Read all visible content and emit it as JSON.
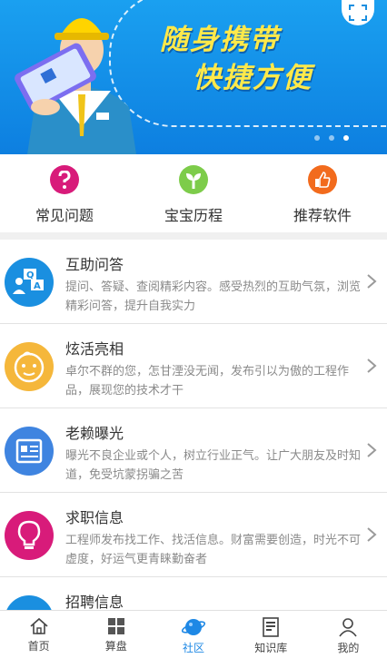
{
  "banner": {
    "line1": "随身携带",
    "line2": "快捷方便",
    "slide_count": 3,
    "active_slide": 2
  },
  "quick": [
    {
      "label": "常见问题",
      "icon": "question-icon",
      "color": "#d81b7a"
    },
    {
      "label": "宝宝历程",
      "icon": "sprout-icon",
      "color": "#7dcc4a"
    },
    {
      "label": "推荐软件",
      "icon": "thumbs-up-icon",
      "color": "#f26b1d"
    }
  ],
  "list": [
    {
      "title": "互助问答",
      "desc": "提问、答疑、查阅精彩内容。感受热烈的互助气氛，浏览精彩问答，提升自我实力",
      "icon": "qa-icon",
      "color": "#1a8fe0"
    },
    {
      "title": "炫活亮相",
      "desc": "卓尔不群的您，怎甘湮没无闻，发布引以为傲的工程作品，展现您的技术才干",
      "icon": "face-icon",
      "color": "#f5b73b"
    },
    {
      "title": "老赖曝光",
      "desc": "曝光不良企业或个人，树立行业正气。让广大朋友及时知道，免受坑蒙拐骗之苦",
      "icon": "id-card-icon",
      "color": "#3f84e0"
    },
    {
      "title": "求职信息",
      "desc": "工程师发布找工作、找活信息。财富需要创造，时光不可虚度，好运气更青睐勤奋者",
      "icon": "lightbulb-icon",
      "color": "#d81b7a"
    },
    {
      "title": "招聘信息",
      "desc": "",
      "icon": "briefcase-icon",
      "color": "#1a8fe0"
    }
  ],
  "tabs": [
    {
      "label": "首页",
      "icon": "home-icon"
    },
    {
      "label": "算盘",
      "icon": "grid-icon"
    },
    {
      "label": "社区",
      "icon": "planet-icon",
      "active": true
    },
    {
      "label": "知识库",
      "icon": "book-icon"
    },
    {
      "label": "我的",
      "icon": "person-icon"
    }
  ],
  "colors": {
    "accent": "#1e88e5",
    "banner_text": "#ffe94a"
  }
}
